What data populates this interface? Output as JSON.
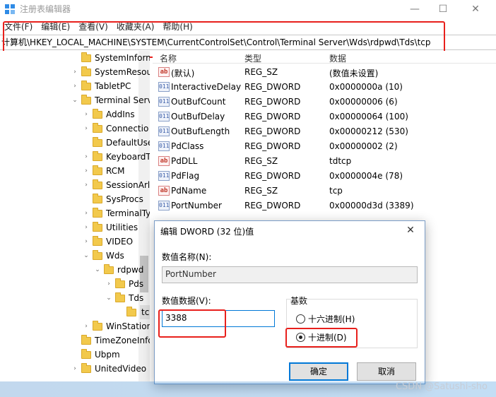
{
  "window": {
    "title": "注册表编辑器",
    "minimize": "—",
    "maximize": "☐",
    "close": "✕"
  },
  "menu": [
    "文件(F)",
    "编辑(E)",
    "查看(V)",
    "收藏夹(A)",
    "帮助(H)"
  ],
  "address": "计算机\\HKEY_LOCAL_MACHINE\\SYSTEM\\CurrentControlSet\\Control\\Terminal Server\\Wds\\rdpwd\\Tds\\tcp",
  "tree": [
    {
      "label": "SystemInforma",
      "expander": "",
      "level": 0
    },
    {
      "label": "SystemResour",
      "expander": "›",
      "level": 0
    },
    {
      "label": "TabletPC",
      "expander": "›",
      "level": 0
    },
    {
      "label": "Terminal Serv",
      "expander": "⌄",
      "level": 0
    },
    {
      "label": "AddIns",
      "expander": "›",
      "level": 1
    },
    {
      "label": "Connectio",
      "expander": "›",
      "level": 1
    },
    {
      "label": "DefaultUse",
      "expander": "",
      "level": 1
    },
    {
      "label": "KeyboardT",
      "expander": "›",
      "level": 1
    },
    {
      "label": "RCM",
      "expander": "›",
      "level": 1
    },
    {
      "label": "SessionArl",
      "expander": "›",
      "level": 1
    },
    {
      "label": "SysProcs",
      "expander": "",
      "level": 1
    },
    {
      "label": "TerminalTy",
      "expander": "›",
      "level": 1
    },
    {
      "label": "Utilities",
      "expander": "›",
      "level": 1
    },
    {
      "label": "VIDEO",
      "expander": "›",
      "level": 1
    },
    {
      "label": "Wds",
      "expander": "⌄",
      "level": 1
    },
    {
      "label": "rdpwd",
      "expander": "⌄",
      "level": 2
    },
    {
      "label": "Pds",
      "expander": "›",
      "level": 3
    },
    {
      "label": "Tds",
      "expander": "⌄",
      "level": 3
    },
    {
      "label": "tc",
      "expander": "",
      "level": 4,
      "selected": true
    },
    {
      "label": "WinStation",
      "expander": "›",
      "level": 1
    },
    {
      "label": "TimeZoneInfor",
      "expander": "",
      "level": 0
    },
    {
      "label": "Ubpm",
      "expander": "",
      "level": 0
    },
    {
      "label": "UnitedVideo",
      "expander": "›",
      "level": 0
    }
  ],
  "list": {
    "columns": [
      "名称",
      "类型",
      "数据"
    ],
    "rows": [
      {
        "icon": "ab",
        "name": "(默认)",
        "type": "REG_SZ",
        "data": "(数值未设置)"
      },
      {
        "icon": "bin",
        "name": "InteractiveDelay",
        "type": "REG_DWORD",
        "data": "0x0000000a (10)"
      },
      {
        "icon": "bin",
        "name": "OutBufCount",
        "type": "REG_DWORD",
        "data": "0x00000006 (6)"
      },
      {
        "icon": "bin",
        "name": "OutBufDelay",
        "type": "REG_DWORD",
        "data": "0x00000064 (100)"
      },
      {
        "icon": "bin",
        "name": "OutBufLength",
        "type": "REG_DWORD",
        "data": "0x00000212 (530)"
      },
      {
        "icon": "bin",
        "name": "PdClass",
        "type": "REG_DWORD",
        "data": "0x00000002 (2)"
      },
      {
        "icon": "ab",
        "name": "PdDLL",
        "type": "REG_SZ",
        "data": "tdtcp"
      },
      {
        "icon": "bin",
        "name": "PdFlag",
        "type": "REG_DWORD",
        "data": "0x0000004e (78)"
      },
      {
        "icon": "ab",
        "name": "PdName",
        "type": "REG_SZ",
        "data": "tcp"
      },
      {
        "icon": "bin",
        "name": "PortNumber",
        "type": "REG_DWORD",
        "data": "0x00000d3d (3389)"
      }
    ]
  },
  "dialog": {
    "title": "编辑 DWORD (32 位)值",
    "close": "✕",
    "name_label": "数值名称(N):",
    "name_value": "PortNumber",
    "data_label": "数值数据(V):",
    "data_value": "3388",
    "base_label": "基数",
    "hex_label": "十六进制(H)",
    "dec_label": "十进制(D)",
    "ok_label": "确定",
    "cancel_label": "取消"
  },
  "watermark": "CSDN @Satushi-sho",
  "colors": {
    "highlight_red": "#e8201c",
    "accent_blue": "#0078d7"
  }
}
